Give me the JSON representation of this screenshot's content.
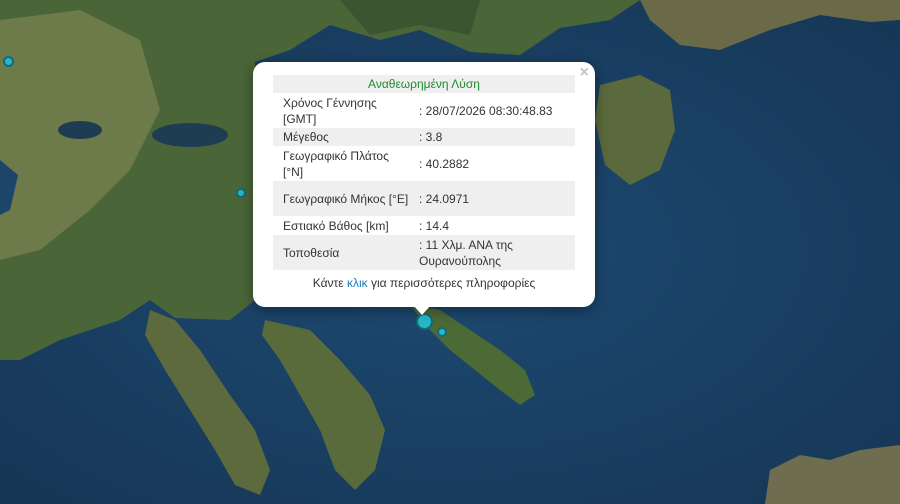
{
  "popup": {
    "title": "Αναθεωρημένη Λύση",
    "close_glyph": "×",
    "rows": [
      {
        "label": "Χρόνος Γέννησης [GMT]",
        "value": ": 28/07/2026 08:30:48.83"
      },
      {
        "label": "Μέγεθος",
        "value": ": 3.8"
      },
      {
        "label": "Γεωγραφικό Πλάτος [°N]",
        "value": ": 40.2882"
      },
      {
        "label": "Γεωγραφικό Μήκος [°E]",
        "value": ": 24.0971"
      },
      {
        "label": "Εστιακό Βάθος [km]",
        "value": ": 14.4"
      },
      {
        "label": "Τοποθεσία",
        "value": ": 11 Χλμ. ΑΝΑ της Ουρανούπολης"
      }
    ],
    "more_prefix": "Κάντε ",
    "more_link": "κλικ",
    "more_suffix": " για περισσότερες πληροφορίες"
  },
  "colors": {
    "marker": "#26b7c8",
    "title_text": "#1e8a2e",
    "link": "#1e7ab8",
    "sea": "#1a3a5c",
    "land": "#4e6b3a"
  },
  "markers": [
    {
      "name": "epicenter-main"
    },
    {
      "name": "epicenter-small"
    },
    {
      "name": "epicenter-west"
    },
    {
      "name": "epicenter-inland"
    }
  ]
}
